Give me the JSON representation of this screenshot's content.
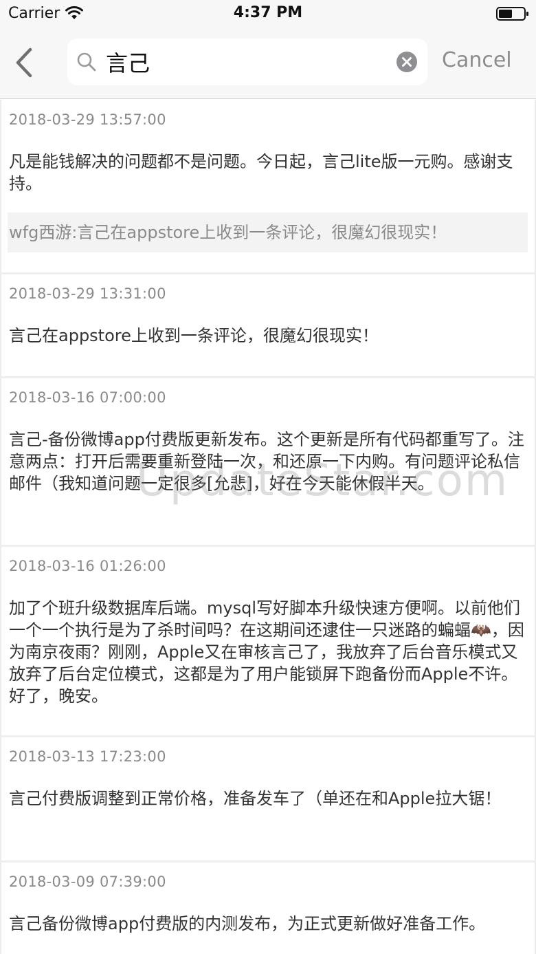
{
  "status_bar": {
    "carrier": "Carrier",
    "time": "4:37 PM",
    "icons": [
      "wifi-icon",
      "battery-icon"
    ]
  },
  "nav": {
    "back_icon": "chevron-left-icon",
    "search_icon": "magnifier-icon",
    "search_value": "言己",
    "clear_icon": "clear-circle-icon",
    "cancel_label": "Cancel"
  },
  "posts": [
    {
      "date": "2018-03-29 13:57:00",
      "text": "凡是能钱解决的问题都不是问题。今日起，言己lite版一元购。感谢支持。",
      "quote": "wfg西游:言己在appstore上收到一条评论，很魔幻很现实！"
    },
    {
      "date": "2018-03-29 13:31:00",
      "text": "言己在appstore上收到一条评论，很魔幻很现实！"
    },
    {
      "date": "2018-03-16 07:00:00",
      "text": "言己-备份微博app付费版更新发布。这个更新是所有代码都重写了。注意两点：打开后需要重新登陆一次，和还原一下内购。有问题评论私信邮件（我知道问题一定很多[允悲]，好在今天能休假半天。"
    },
    {
      "date": "2018-03-16 01:26:00",
      "text": "加了个班升级数据库后端。mysql写好脚本升级快速方便啊。以前他们一个一个执行是为了杀时间吗？在这期间还逮住一只迷路的蝙蝠🦇，因为南京夜雨？刚刚，Apple又在审核言己了，我放弃了后台音乐模式又放弃了后台定位模式，这都是为了用户能锁屏下跑备份而Apple不许。好了，晚安。"
    },
    {
      "date": "2018-03-13 17:23:00",
      "text": "言己付费版调整到正常价格，准备发车了（单还在和Apple拉大锯！"
    },
    {
      "date": "2018-03-09 07:39:00",
      "text": "言己备份微博app付费版的内测发布，为正式更新做好准备工作。"
    }
  ],
  "watermark": "UpdateStar.com",
  "colors": {
    "nav_background": "#f7f7f7",
    "cancel_text": "#8c8c8c",
    "date_text": "#8a8a8a",
    "quote_background": "#f3f3f3"
  }
}
